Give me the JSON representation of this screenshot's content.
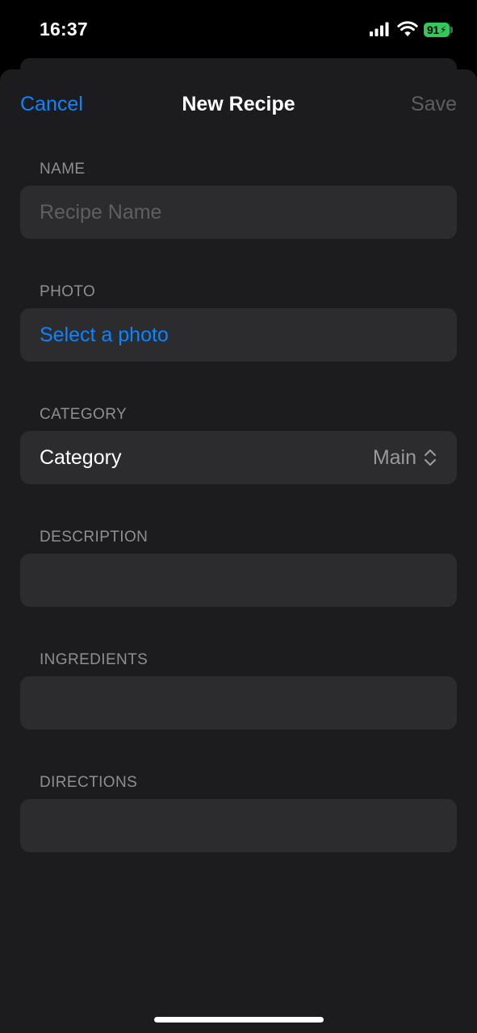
{
  "status_bar": {
    "time": "16:37",
    "battery_level": "91",
    "battery_color": "#34c759"
  },
  "nav": {
    "cancel_label": "Cancel",
    "title": "New Recipe",
    "save_label": "Save",
    "accent_color": "#0a84ff"
  },
  "form": {
    "name": {
      "header": "NAME",
      "placeholder": "Recipe Name",
      "value": ""
    },
    "photo": {
      "header": "PHOTO",
      "action_label": "Select a photo"
    },
    "category": {
      "header": "CATEGORY",
      "label": "Category",
      "selected_value": "Main",
      "icon": "chevron-up-down-icon"
    },
    "description": {
      "header": "DESCRIPTION",
      "value": ""
    },
    "ingredients": {
      "header": "INGREDIENTS",
      "value": ""
    },
    "directions": {
      "header": "DIRECTIONS",
      "value": ""
    }
  }
}
